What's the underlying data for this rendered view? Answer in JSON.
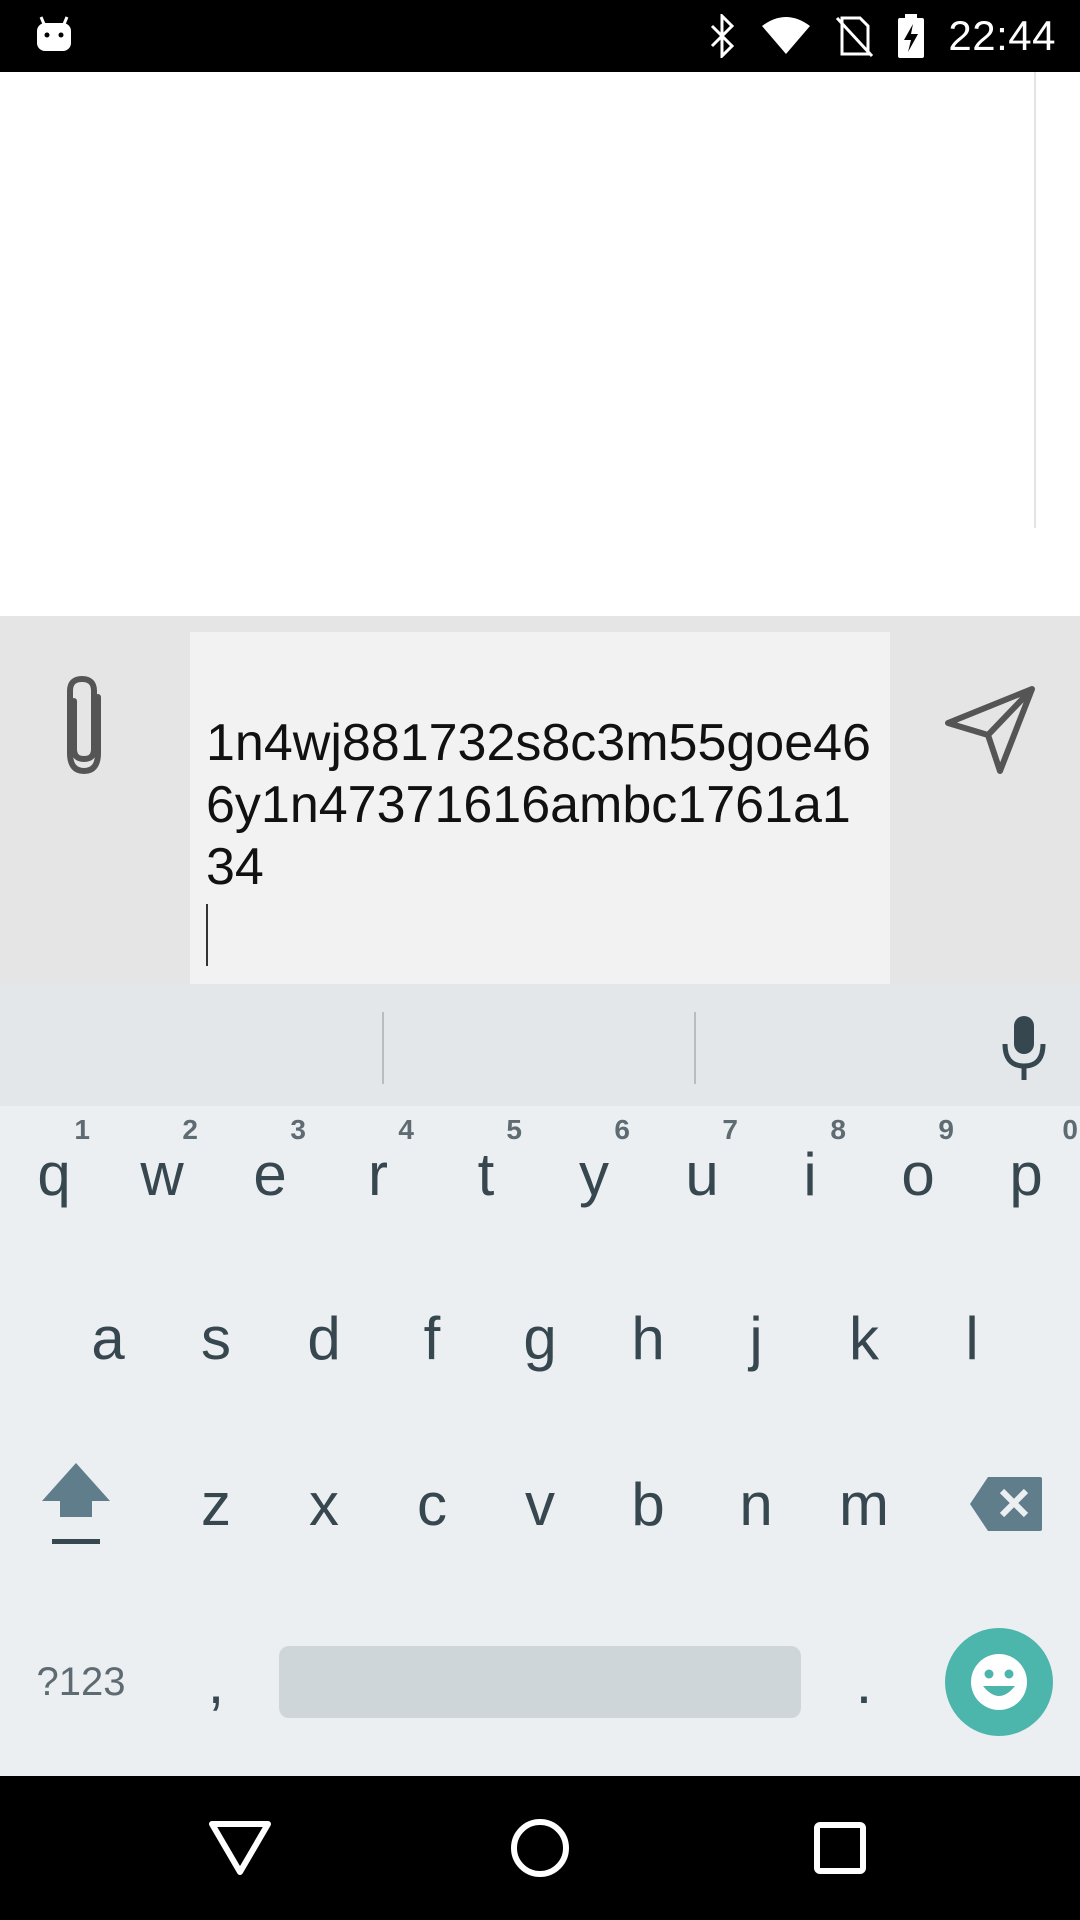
{
  "status_bar": {
    "time": "22:44",
    "icons": [
      "android-notification-icon",
      "bluetooth-icon",
      "wifi-icon",
      "no-sim-icon",
      "battery-charging-icon"
    ]
  },
  "compose": {
    "text": "1n4wj881732s8c3m55goe466y1n47371616ambc1761a134",
    "attach_icon": "paperclip-icon",
    "send_icon": "send-icon"
  },
  "keyboard": {
    "row1": [
      {
        "key": "q",
        "hint": "1"
      },
      {
        "key": "w",
        "hint": "2"
      },
      {
        "key": "e",
        "hint": "3"
      },
      {
        "key": "r",
        "hint": "4"
      },
      {
        "key": "t",
        "hint": "5"
      },
      {
        "key": "y",
        "hint": "6"
      },
      {
        "key": "u",
        "hint": "7"
      },
      {
        "key": "i",
        "hint": "8"
      },
      {
        "key": "o",
        "hint": "9"
      },
      {
        "key": "p",
        "hint": "0"
      }
    ],
    "row2": [
      "a",
      "s",
      "d",
      "f",
      "g",
      "h",
      "j",
      "k",
      "l"
    ],
    "row3": [
      "z",
      "x",
      "c",
      "v",
      "b",
      "n",
      "m"
    ],
    "symbols_label": "?123",
    "comma": ",",
    "period": ".",
    "accent_color": "#4db6ac"
  },
  "nav_bar": {
    "icons": [
      "back-icon",
      "home-icon",
      "recents-icon"
    ]
  }
}
